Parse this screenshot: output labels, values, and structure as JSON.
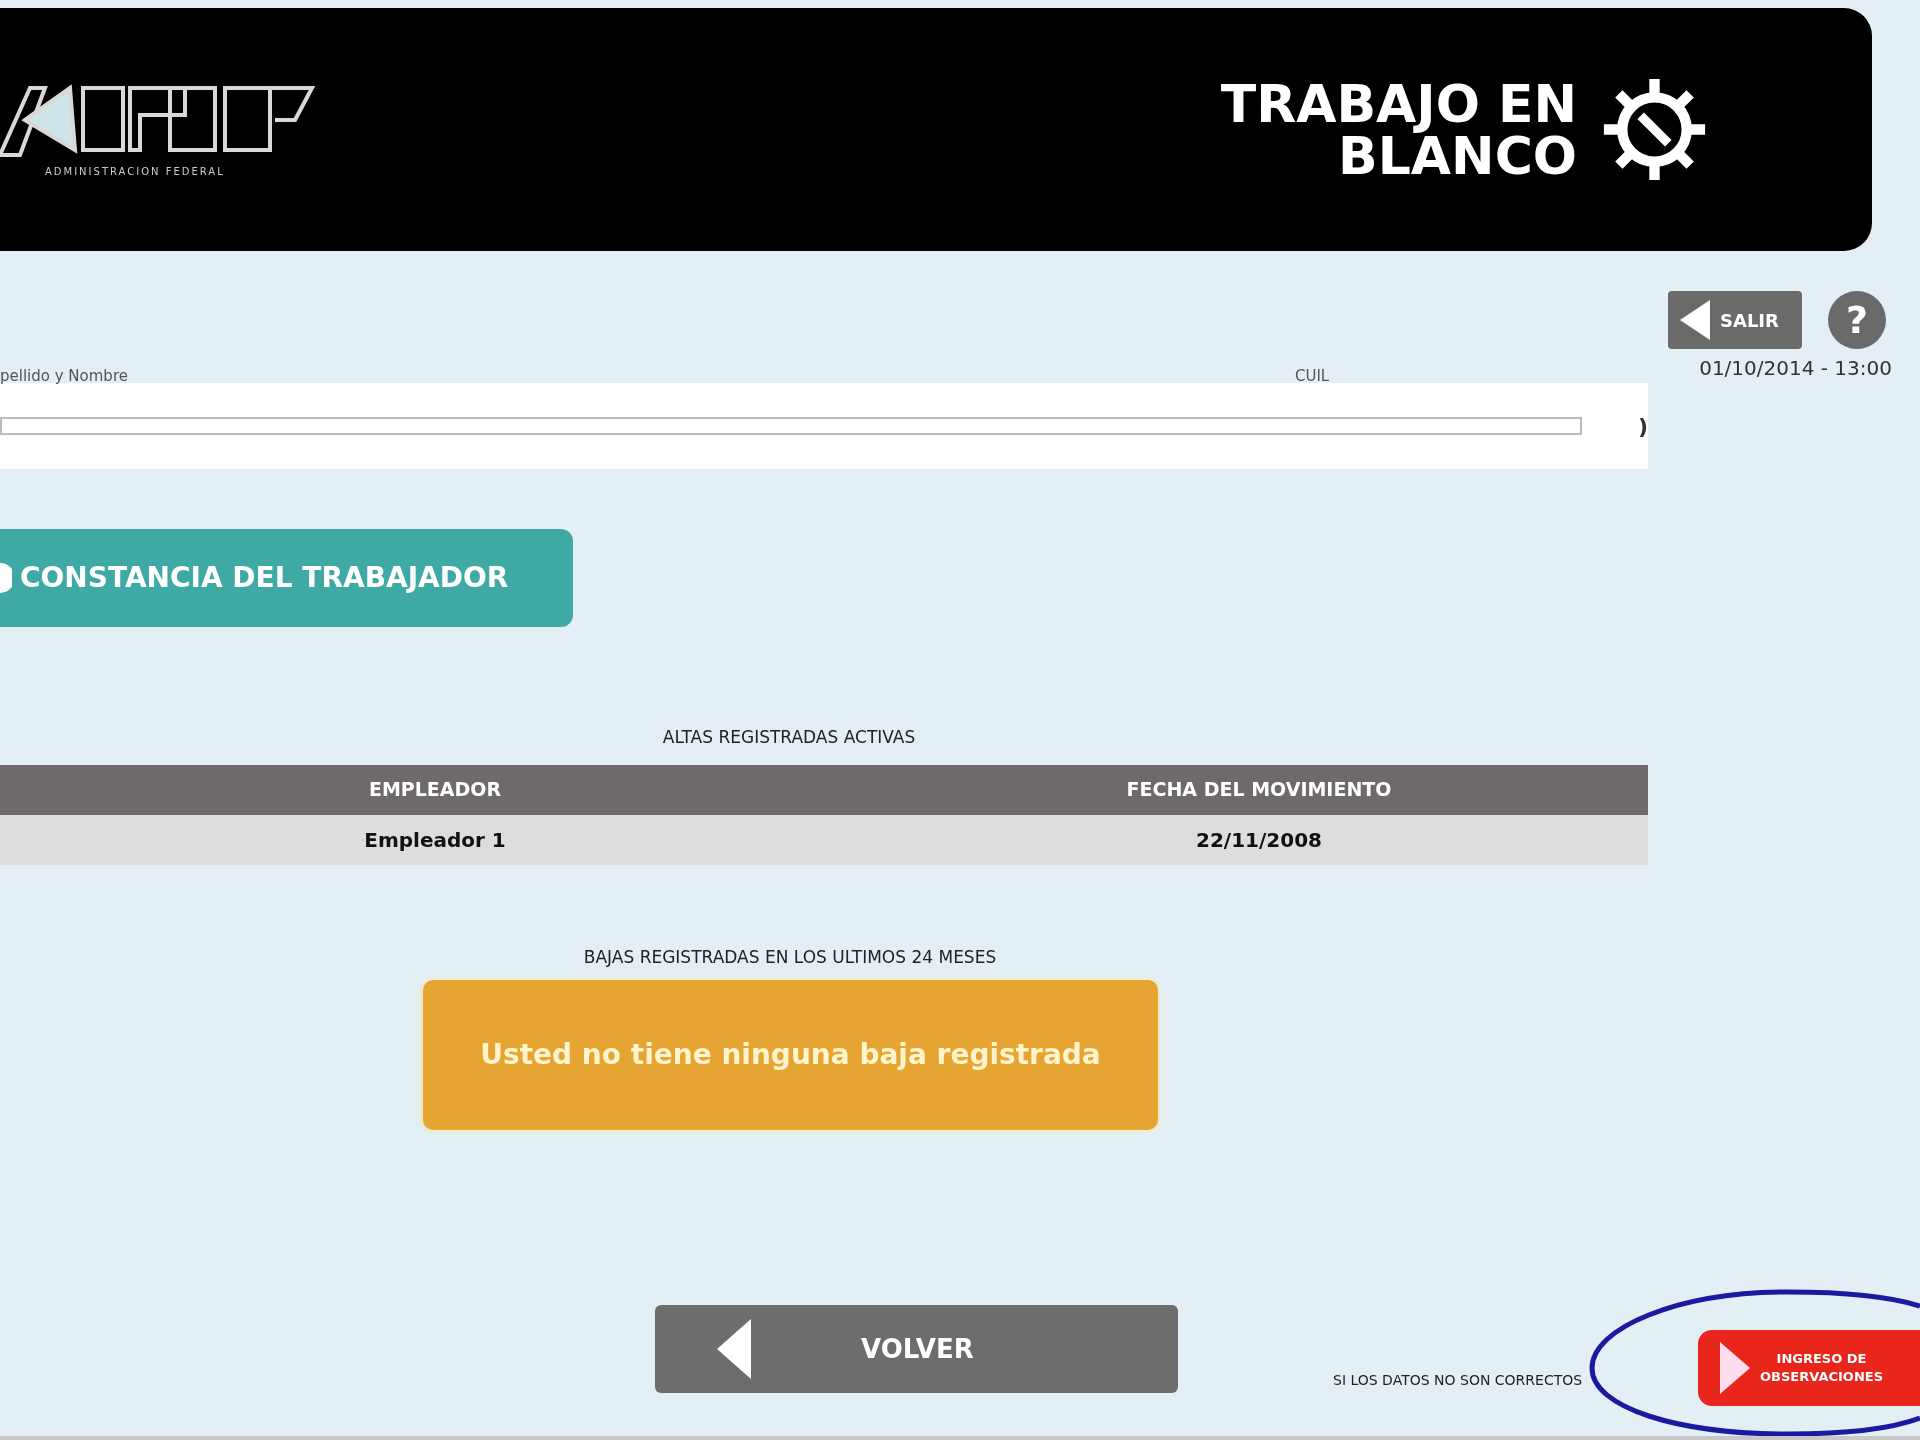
{
  "header": {
    "logo_caption": "ADMINISTRACION FEDERAL",
    "title_line_1": "TRABAJO EN",
    "title_line_2": "BLANCO"
  },
  "session": {
    "exit_button": "SALIR",
    "help_button": "?",
    "datetime": "01/10/2014 - 13:00"
  },
  "worker": {
    "name_label": "pellido y Nombre",
    "cuil_label": "CUIL",
    "trailing": ")"
  },
  "certificate_button": "CONSTANCIA DEL TRABAJADOR",
  "active_registrations": {
    "title": "ALTAS REGISTRADAS ACTIVAS",
    "columns": [
      "EMPLEADOR",
      "FECHA DEL MOVIMIENTO"
    ],
    "rows": [
      [
        "Empleador 1",
        "22/11/2008"
      ]
    ]
  },
  "terminations": {
    "title": "BAJAS REGISTRADAS EN LOS ULTIMOS 24 MESES",
    "message": "Usted no tiene ninguna baja registrada"
  },
  "back_button": "VOLVER",
  "footer": {
    "note": "SI LOS DATOS NO SON CORRECTOS",
    "observations_button_line_1": "INGRESO DE",
    "observations_button_line_2": "OBSERVACIONES"
  }
}
